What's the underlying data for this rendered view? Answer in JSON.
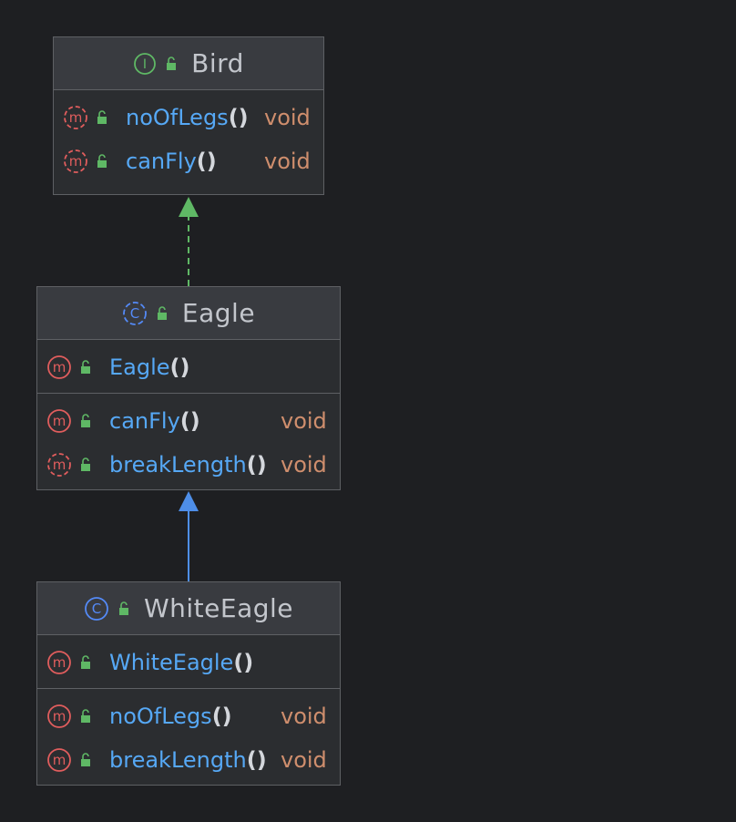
{
  "colors": {
    "background": "#1e1f22",
    "box_fill": "#2b2d30",
    "header_fill": "#393b40",
    "border": "#5e6064",
    "method_name": "#56a8f5",
    "type": "#cf8e6d",
    "interface_icon": "#5fb865",
    "class_icon": "#548af7",
    "method_icon": "#e05d5d",
    "lock_icon": "#5fb865",
    "realization_arrow": "#5fb865",
    "inheritance_arrow": "#4e8ee8"
  },
  "classes": {
    "bird": {
      "kind": "interface",
      "name": "Bird",
      "badge": "I",
      "methods": [
        {
          "name": "noOfLegs",
          "parens": "()",
          "type": "void",
          "abstract": true
        },
        {
          "name": "canFly",
          "parens": "()",
          "type": "void",
          "abstract": true
        }
      ]
    },
    "eagle": {
      "kind": "class",
      "name": "Eagle",
      "badge": "C",
      "constructors": [
        {
          "name": "Eagle",
          "parens": "()"
        }
      ],
      "methods": [
        {
          "name": "canFly",
          "parens": "()",
          "type": "void"
        },
        {
          "name": "breakLength",
          "parens": "()",
          "type": "void",
          "abstract": true
        }
      ]
    },
    "white_eagle": {
      "kind": "class",
      "name": "WhiteEagle",
      "badge": "C",
      "constructors": [
        {
          "name": "WhiteEagle",
          "parens": "()"
        }
      ],
      "methods": [
        {
          "name": "noOfLegs",
          "parens": "()",
          "type": "void"
        },
        {
          "name": "breakLength",
          "parens": "()",
          "type": "void"
        }
      ]
    }
  },
  "relations": [
    {
      "from": "Eagle",
      "to": "Bird",
      "type": "realization"
    },
    {
      "from": "WhiteEagle",
      "to": "Eagle",
      "type": "generalization"
    }
  ]
}
